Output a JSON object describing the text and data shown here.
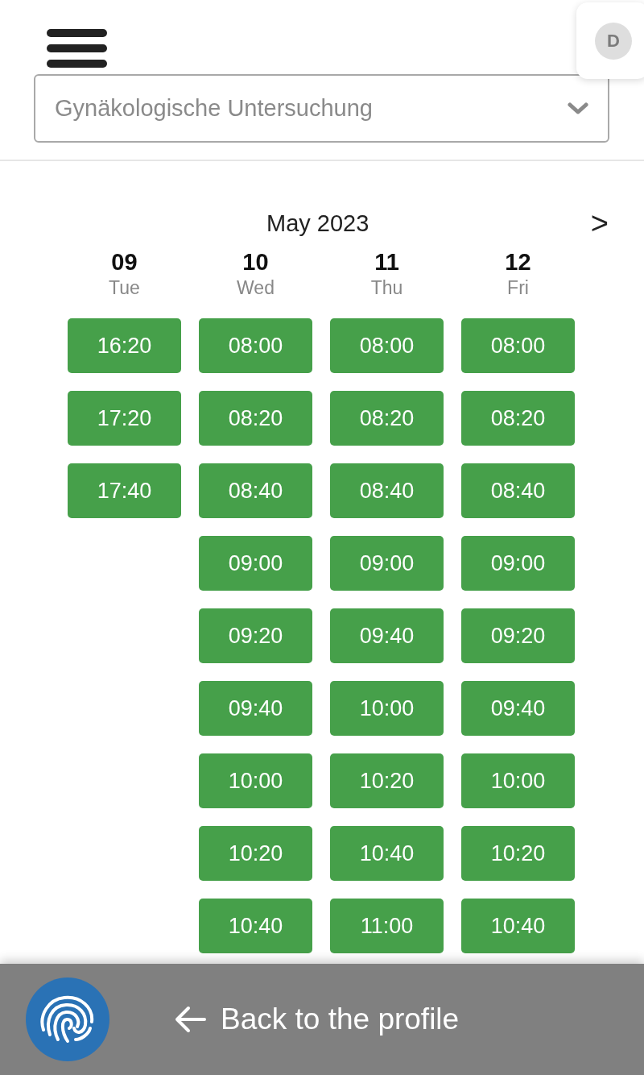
{
  "header": {
    "avatar": "D",
    "service_select": {
      "value": "Gynäkologische Untersuchung"
    }
  },
  "calendar": {
    "month": "May 2023",
    "next": ">",
    "days": [
      {
        "date": "09",
        "weekday": "Tue",
        "slots": [
          "16:20",
          "17:20",
          "17:40"
        ]
      },
      {
        "date": "10",
        "weekday": "Wed",
        "slots": [
          "08:00",
          "08:20",
          "08:40",
          "09:00",
          "09:20",
          "09:40",
          "10:00",
          "10:20",
          "10:40"
        ]
      },
      {
        "date": "11",
        "weekday": "Thu",
        "slots": [
          "08:00",
          "08:20",
          "08:40",
          "09:00",
          "09:40",
          "10:00",
          "10:20",
          "10:40",
          "11:00"
        ]
      },
      {
        "date": "12",
        "weekday": "Fri",
        "slots": [
          "08:00",
          "08:20",
          "08:40",
          "09:00",
          "09:20",
          "09:40",
          "10:00",
          "10:20",
          "10:40"
        ]
      }
    ]
  },
  "bottom_bar": {
    "back_link": "Back to the profile"
  }
}
